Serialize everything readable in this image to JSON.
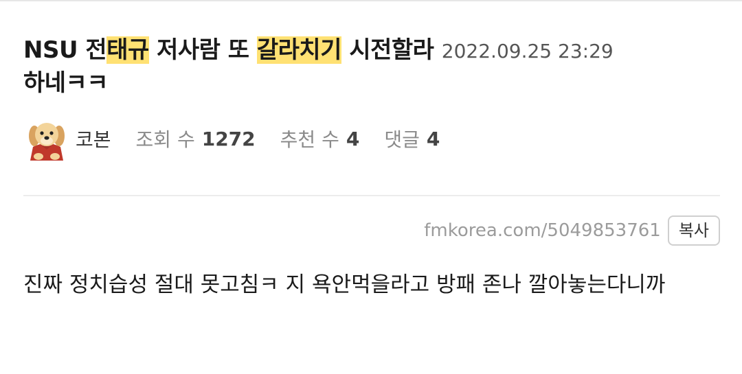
{
  "post": {
    "title_parts": [
      "NSU 전",
      "태규",
      " 저사람 또 ",
      "갈라치기",
      " 시전할라 "
    ],
    "date": "2022.09.25 23:29",
    "title_tail": "하네ㅋㅋ"
  },
  "author": {
    "name": "코본",
    "avatar_icon": "puppy-avatar-icon"
  },
  "stats": {
    "views_label": "조회 수",
    "views": "1272",
    "recommend_label": "추천 수",
    "recommend": "4",
    "comments_label": "댓글",
    "comments": "4"
  },
  "share": {
    "url": "fmkorea.com/5049853761",
    "copy_label": "복사"
  },
  "body": {
    "text": "진짜 정치습성 절대 못고침ㅋ 지 욕안먹을라고 방패 존나 깔아놓는다니까"
  },
  "colors": {
    "highlight": "#ffe173",
    "date": "#555555",
    "meta_label": "#8a8a8a"
  }
}
